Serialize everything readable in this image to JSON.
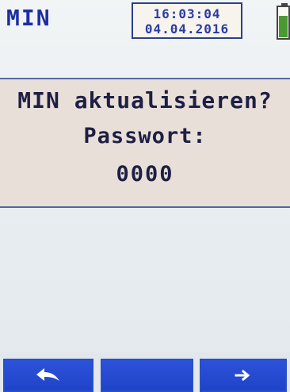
{
  "header": {
    "title": "MIN",
    "time": "16:03:04",
    "date": "04.04.2016",
    "battery_icon": "battery-icon",
    "battery_level": 0.7
  },
  "dialog": {
    "question": "MIN aktualisieren?",
    "password_label": "Passwort:",
    "password_value": "0000"
  },
  "softkeys": {
    "left_icon": "back-arrow-icon",
    "middle_icon": "",
    "right_icon": "right-arrow-icon"
  },
  "colors": {
    "title": "#1d2fa0",
    "softkey": "#2447cf",
    "battery": "#4a9a31"
  }
}
